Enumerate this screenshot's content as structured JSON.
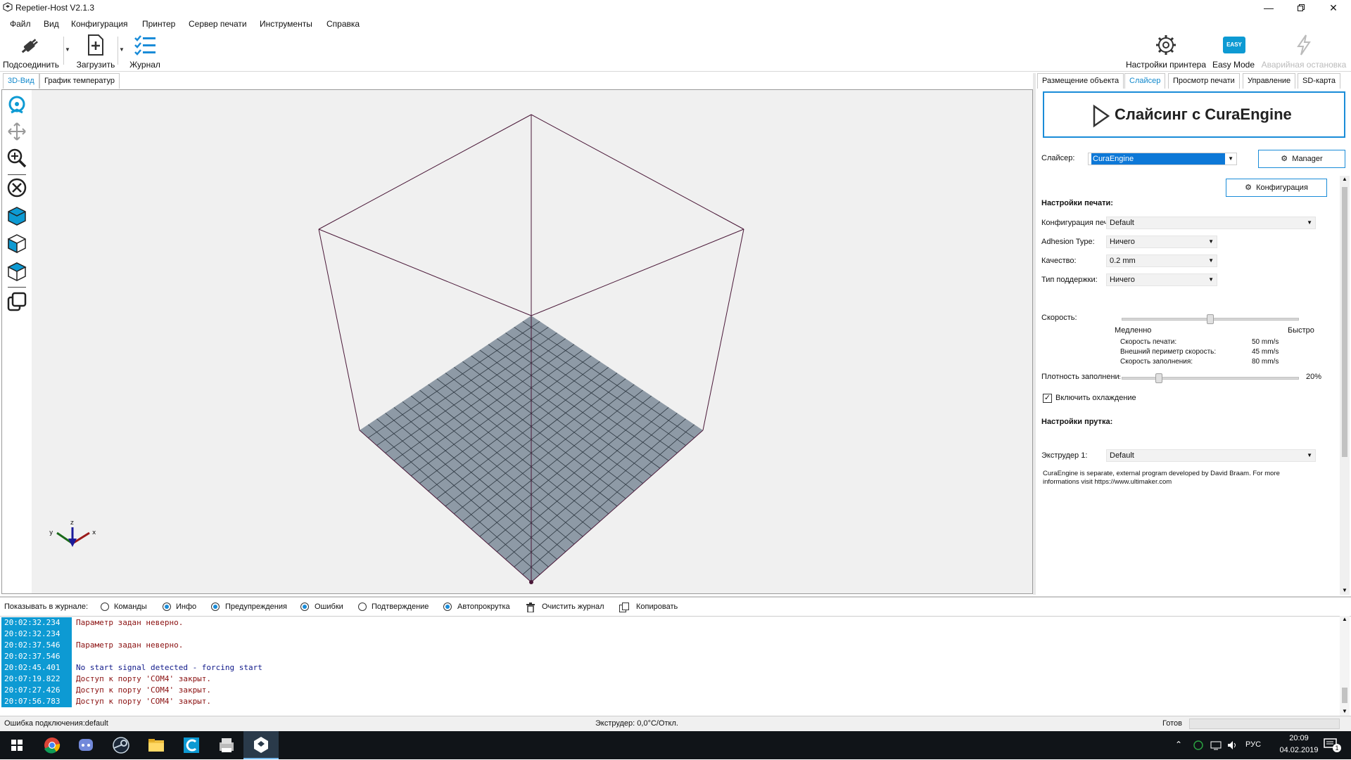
{
  "window": {
    "title": "Repetier-Host V2.1.3",
    "minimize_icon": "minimize-icon",
    "maximize_icon": "restore-icon",
    "close_icon": "close-icon"
  },
  "menu": [
    "Файл",
    "Вид",
    "Конфигурация",
    "Принтер",
    "Сервер печати",
    "Инструменты",
    "Справка"
  ],
  "toolbar": {
    "connect": "Подсоединить",
    "load": "Загрузить",
    "log": "Журнал",
    "printer_settings": "Настройки принтера",
    "easy_mode": "Easy Mode",
    "easy_badge": "EASY",
    "emergency_stop": "Аварийная остановка"
  },
  "left_tabs": [
    "3D-Вид",
    "График температур"
  ],
  "right_tabs": [
    "Размещение объекта",
    "Слайсер",
    "Просмотр печати",
    "Управление",
    "SD-карта"
  ],
  "slicer": {
    "slice_button": "Слайсинг с CuraEngine",
    "slicer_label": "Слайсер:",
    "slicer_value": "CuraEngine",
    "manager_button": "Manager",
    "config_button": "Конфигурация",
    "print_settings_heading": "Настройки печати:",
    "print_config_label": "Конфигурация печати:",
    "print_config_value": "Default",
    "adhesion_label": "Adhesion Type:",
    "adhesion_value": "Ничего",
    "quality_label": "Качество:",
    "quality_value": "0.2 mm",
    "support_label": "Тип поддержки:",
    "support_value": "Ничего",
    "speed_label": "Скорость:",
    "speed_slow": "Медленно",
    "speed_fast": "Быстро",
    "speed_level": 0.5,
    "print_speed_label": "Скорость печати:",
    "print_speed_value": "50 mm/s",
    "perimeter_speed_label": "Внешний периметр скорость:",
    "perimeter_speed_value": "45 mm/s",
    "infill_speed_label": "Скорость заполнения:",
    "infill_speed_value": "80 mm/s",
    "infill_density_label": "Плотность заполнения:",
    "infill_density_value": "20%",
    "infill_level": 0.2,
    "cooling_label": "Включить охлаждение",
    "cooling_checked": true,
    "filament_heading": "Настройки прутка:",
    "extruder_label": "Экструдер 1:",
    "extruder_value": "Default",
    "info_text_1": "CuraEngine is separate, external program developed by David Braam. For more",
    "info_text_2": "informations visit https://www.ultimaker.com"
  },
  "log_filter": {
    "label": "Показывать в журнале:",
    "options": [
      {
        "label": "Команды",
        "checked": false
      },
      {
        "label": "Инфо",
        "checked": true
      },
      {
        "label": "Предупреждения",
        "checked": true
      },
      {
        "label": "Ошибки",
        "checked": true
      },
      {
        "label": "Подтверждение",
        "checked": false
      },
      {
        "label": "Автопрокрутка",
        "checked": true
      }
    ],
    "clear": "Очистить журнал",
    "copy": "Копировать"
  },
  "log": [
    {
      "time": "20:02:32.234",
      "msg": "Параметр задан неверно.",
      "type": "error"
    },
    {
      "time": "20:02:32.234",
      "msg": "",
      "type": "error"
    },
    {
      "time": "20:02:37.546",
      "msg": "Параметр задан неверно.",
      "type": "error"
    },
    {
      "time": "20:02:37.546",
      "msg": "",
      "type": "error"
    },
    {
      "time": "20:02:45.401",
      "msg": "No start signal detected - forcing start",
      "type": "info"
    },
    {
      "time": "20:07:19.822",
      "msg": "Доступ к порту 'COM4' закрыт.",
      "type": "error"
    },
    {
      "time": "20:07:27.426",
      "msg": "Доступ к порту 'COM4' закрыт.",
      "type": "error"
    },
    {
      "time": "20:07:56.783",
      "msg": "Доступ к порту 'COM4' закрыт.",
      "type": "error"
    }
  ],
  "status": {
    "connection": "Ошибка подключения:default",
    "extruder": "Экструдер: 0,0°C/Откл.",
    "ready": "Готов"
  },
  "taskbar": {
    "language": "РУС",
    "time": "20:09",
    "date": "04.02.2019",
    "notification_count": "1"
  }
}
